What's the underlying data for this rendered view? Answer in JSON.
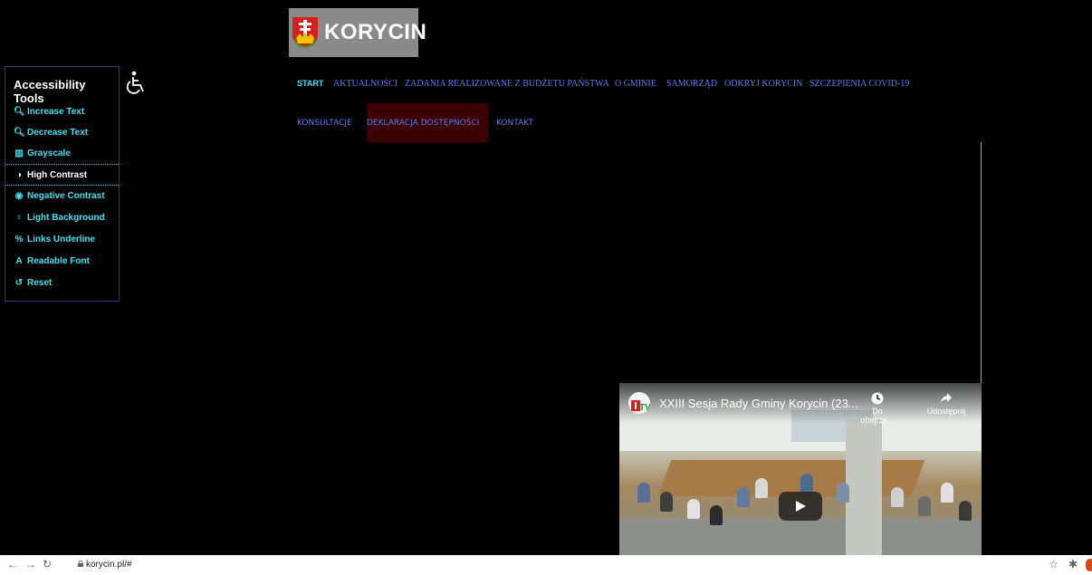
{
  "logo": {
    "text": "KORYCIN"
  },
  "accessibility": {
    "title": "Accessibility Tools",
    "tools": [
      {
        "label": "Increase Text",
        "icon": "zoom-in-icon",
        "glyph": "🔍︎"
      },
      {
        "label": "Decrease Text",
        "icon": "zoom-out-icon",
        "glyph": "🔍︎"
      },
      {
        "label": "Grayscale",
        "icon": "bars-icon",
        "glyph": "▥"
      },
      {
        "label": "High Contrast",
        "icon": "contrast-icon",
        "glyph": "◑",
        "active": true
      },
      {
        "label": "Negative Contrast",
        "icon": "eye-icon",
        "glyph": "◉"
      },
      {
        "label": "Light Background",
        "icon": "lightbulb-icon",
        "glyph": "♀"
      },
      {
        "label": "Links Underline",
        "icon": "link-icon",
        "glyph": "%"
      },
      {
        "label": "Readable Font",
        "icon": "font-icon",
        "glyph": "A"
      },
      {
        "label": "Reset",
        "icon": "reset-icon",
        "glyph": "↺"
      }
    ]
  },
  "nav": {
    "row1": [
      "START",
      "AKTUALNOŚCI",
      "ZADANIA REALIZOWANE Z BUDŻETU PAŃSTWA",
      "O GMINIE",
      "SAMORZĄD",
      "ODKRYJ KORYCIN",
      "SZCZEPIENIA COVID-19"
    ],
    "row2": [
      "KONSULTACJE",
      "DEKLARACJA DOSTĘPNOŚCI",
      "KONTAKT"
    ]
  },
  "video": {
    "title": "XXIII Sesja Rady Gminy Korycin (23...",
    "watch_later": "Do obejrze...",
    "share": "Udostępnij"
  },
  "browser": {
    "url": "korycin.pl/#"
  },
  "colors": {
    "nav": "#5a7cf0",
    "accent": "#3fe0f0",
    "highlight": "#3c0000"
  }
}
